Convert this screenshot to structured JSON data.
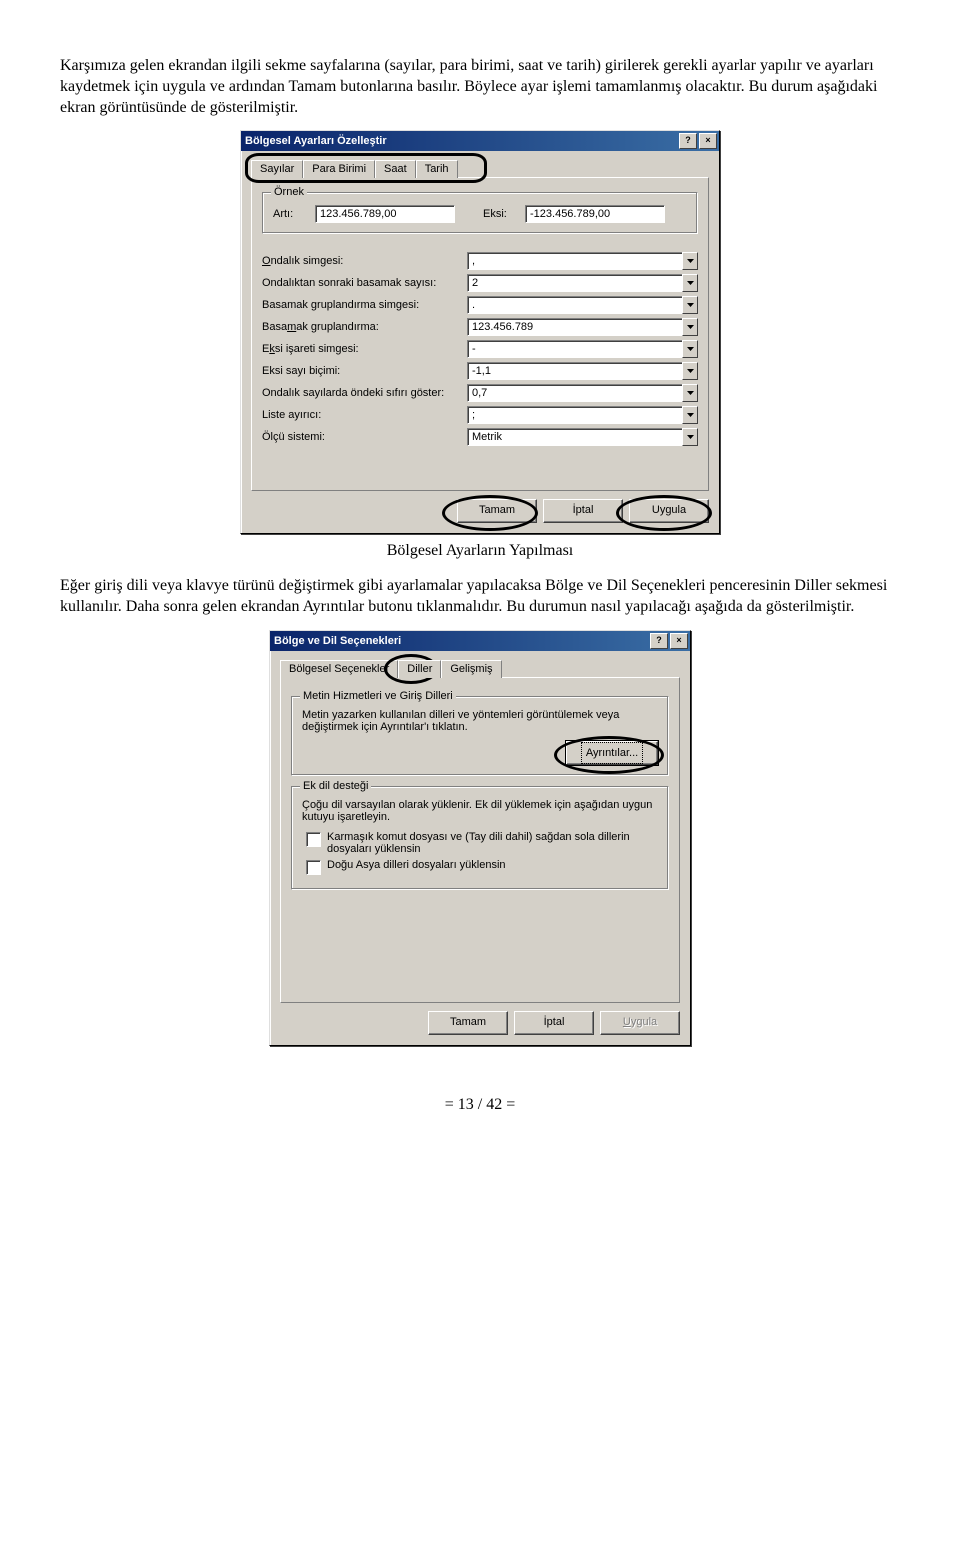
{
  "paragraphs": {
    "p1": "Karşımıza gelen ekrandan ilgili sekme sayfalarına (sayılar, para birimi, saat ve tarih) girilerek gerekli ayarlar yapılır ve ayarları kaydetmek için uygula ve ardından Tamam butonlarına basılır. Böylece ayar işlemi tamamlanmış olacaktır. Bu durum aşağıdaki ekran görüntüsünde de gösterilmiştir.",
    "caption1": "Bölgesel Ayarların Yapılması",
    "p2": "Eğer giriş dili veya klavye türünü değiştirmek gibi ayarlamalar yapılacaksa Bölge ve Dil Seçenekleri penceresinin Diller sekmesi kullanılır. Daha sonra gelen ekrandan Ayrıntılar butonu tıklanmalıdır. Bu durumun nasıl yapılacağı aşağıda da gösterilmiştir.",
    "footer": "= 13 / 42 ="
  },
  "titlebar_help": "?",
  "titlebar_close": "×",
  "dialog1": {
    "title": "Bölgesel Ayarları Özelleştir",
    "tabs": {
      "t1": "Sayılar",
      "t2": "Para Birimi",
      "t3": "Saat",
      "t4": "Tarih"
    },
    "ornek": {
      "group": "Örnek",
      "arti_label": "Artı:",
      "arti_value": "123.456.789,00",
      "eksi_label": "Eksi:",
      "eksi_value": "-123.456.789,00"
    },
    "fields": {
      "f1_label": "Ondalık simgesi:",
      "f1_value": ",",
      "f2_label": "Ondalıktan sonraki basamak sayısı:",
      "f2_value": "2",
      "f3_label": "Basamak gruplandırma simgesi:",
      "f3_value": ".",
      "f4_label": "Basamak gruplandırma:",
      "f4_value": "123.456.789",
      "f5_label": "Eksi işareti simgesi:",
      "f5_value": "-",
      "f6_label": "Eksi sayı biçimi:",
      "f6_value": "-1,1",
      "f7_label": "Ondalık sayılarda öndeki sıfırı göster:",
      "f7_value": "0,7",
      "f8_label": "Liste ayırıcı:",
      "f8_value": ";",
      "f9_label": "Ölçü sistemi:",
      "f9_value": "Metrik"
    },
    "buttons": {
      "ok": "Tamam",
      "cancel": "İptal",
      "apply": "Uygula"
    }
  },
  "dialog2": {
    "title": "Bölge ve Dil Seçenekleri",
    "tabs": {
      "t1": "Bölgesel Seçenekler",
      "t2": "Diller",
      "t3": "Gelişmiş"
    },
    "group1": {
      "title": "Metin Hizmetleri ve Giriş Dilleri",
      "text": "Metin yazarken kullanılan dilleri ve yöntemleri görüntülemek veya değiştirmek için Ayrıntılar'ı tıklatın.",
      "details_btn": "Ayrıntılar..."
    },
    "group2": {
      "title": "Ek dil desteği",
      "text": "Çoğu dil varsayılan olarak yüklenir. Ek dil yüklemek için aşağıdan uygun kutuyu işaretleyin.",
      "chk1": "Karmaşık komut dosyası ve (Tay dili dahil) sağdan sola dillerin dosyaları yüklensin",
      "chk2": "Doğu Asya dilleri dosyaları yüklensin"
    },
    "buttons": {
      "ok": "Tamam",
      "cancel": "İptal",
      "apply": "Uygula"
    }
  }
}
